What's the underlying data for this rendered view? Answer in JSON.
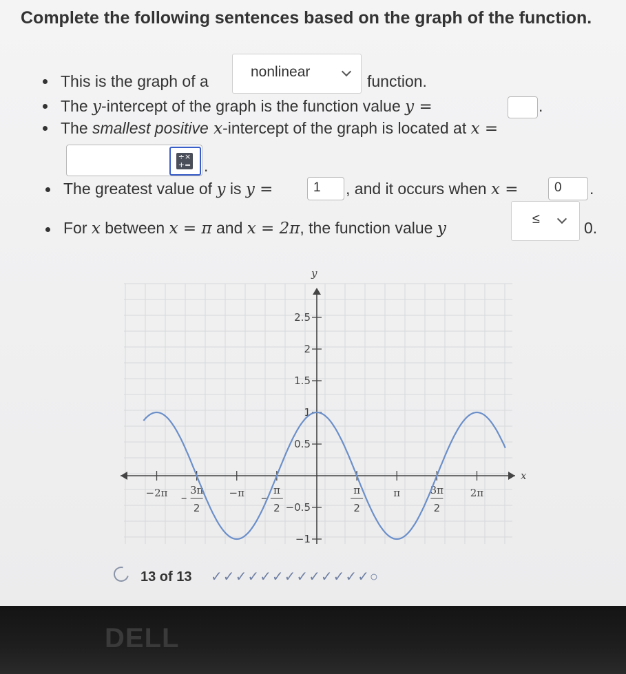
{
  "title": "Complete the following sentences based on the graph of the function.",
  "s1": {
    "pre": "This is the graph of a",
    "dropdown": "nonlinear",
    "post": "function."
  },
  "s2": {
    "pre": "The ",
    "y": "y",
    "mid": "-intercept of the graph is the function value ",
    "eq": "y =",
    "post": "."
  },
  "s3": {
    "pre": "The ",
    "em": "smallest positive",
    "x": " x",
    "mid": "-intercept of the graph is located at ",
    "eq": "x =",
    "post": "."
  },
  "s4": {
    "pre": "The greatest value of ",
    "y": "y",
    "is": " is ",
    "eq1": "y =",
    "v1": "1",
    "mid": ", and it occurs when ",
    "eq2": "x =",
    "v2": "0",
    "post": "."
  },
  "s5": {
    "pre": "For ",
    "x": "x",
    "mid1": " between ",
    "eq1": "x = π",
    "and": " and ",
    "eq2": "x = 2π",
    "mid2": ", the function value ",
    "y": "y",
    "dropdown": "≤",
    "post": "0."
  },
  "graph": {
    "axis_x_label": "x",
    "axis_y_label": "y",
    "x_ticks": [
      "−2π",
      "3π",
      "2",
      "−π",
      "π",
      "2",
      "−0.5",
      "π",
      "2",
      "π",
      "3π",
      "2",
      "2π"
    ],
    "y_ticks": [
      "2.5",
      "2",
      "1.5",
      "1",
      "0.5",
      "−1"
    ],
    "curve_color": "#6b8fc9"
  },
  "chart_data": {
    "type": "line",
    "function": "cos(x)",
    "x_unit": "radians",
    "xlim": [
      -6.8,
      7.4
    ],
    "ylim": [
      -1,
      3
    ],
    "series": [
      {
        "x": [
          -6.8,
          -6.283,
          -5.5,
          -4.712,
          -3.927,
          -3.1416,
          -2.356,
          -1.571,
          -0.785,
          0,
          0.785,
          1.571,
          2.356,
          3.1416,
          3.927,
          4.712,
          5.5,
          6.283,
          7.4
        ],
        "y": [
          0.869,
          1,
          0.709,
          0,
          -0.707,
          -1,
          -0.707,
          0,
          0.707,
          1,
          0.707,
          0,
          -0.707,
          -1,
          -0.707,
          0,
          0.709,
          1,
          0.438
        ]
      }
    ],
    "grid": true
  },
  "progress": {
    "label": "13 of 13",
    "checks": "✓✓✓✓✓✓✓✓✓✓✓✓✓○"
  },
  "brand": "DELL"
}
